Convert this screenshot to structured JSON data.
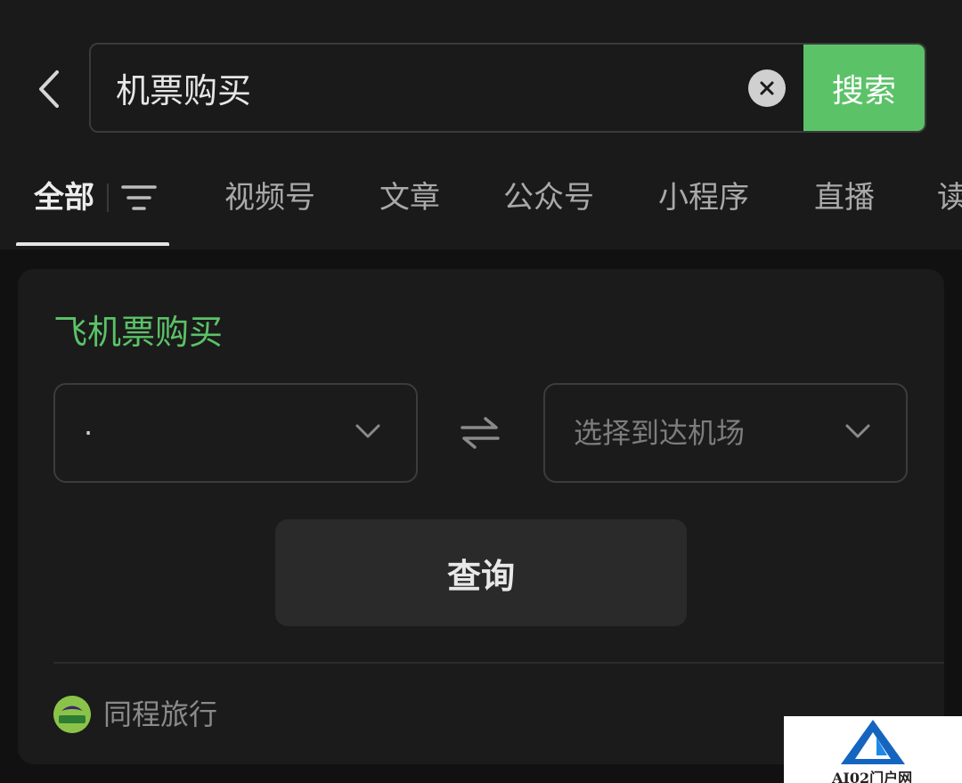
{
  "search": {
    "query": "机票购买",
    "button_label": "搜索"
  },
  "tabs": [
    {
      "label": "全部"
    },
    {
      "label": "视频号"
    },
    {
      "label": "文章"
    },
    {
      "label": "公众号"
    },
    {
      "label": "小程序"
    },
    {
      "label": "直播"
    },
    {
      "label": "读"
    }
  ],
  "card": {
    "title": "飞机票购买",
    "departure_value": "·",
    "arrival_placeholder": "选择到达机场",
    "query_label": "查询",
    "provider": "同程旅行",
    "provider_logo_text": "同程旅行"
  },
  "watermark": {
    "text": "AI02门户网"
  },
  "colors": {
    "accent": "#5bc268",
    "background": "#111111",
    "card": "#1b1b1b"
  }
}
